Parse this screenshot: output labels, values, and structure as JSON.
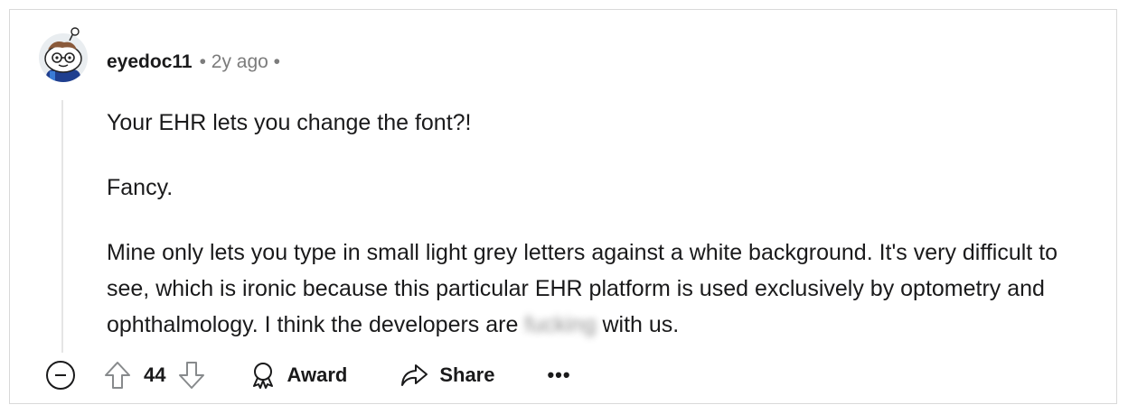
{
  "comment": {
    "author": "eyedoc11",
    "time_meta": "• 2y ago •",
    "paragraphs": [
      "Your EHR lets you change the font?!",
      "Fancy.",
      "Mine only lets you type in small light grey letters against a white background. It's very difficult to see, which is ironic because this particular EHR platform is used exclusively by optometry and ophthalmology. I think the developers are"
    ],
    "blurred_word": "fucking",
    "last_paragraph_tail": "with us."
  },
  "actions": {
    "vote_count": "44",
    "award_label": "Award",
    "share_label": "Share",
    "more_label": "•••"
  },
  "icons": {
    "collapse": "collapse-icon",
    "upvote": "upvote-arrow-icon",
    "downvote": "downvote-arrow-icon",
    "award": "award-icon",
    "share": "share-icon",
    "more": "more-icon",
    "avatar": "snoo-avatar"
  },
  "colors": {
    "text": "#1a1a1b",
    "meta": "#7c7c7c",
    "thread_line": "#e5e5e5",
    "avatar_shirt": "#1f3f8f"
  }
}
